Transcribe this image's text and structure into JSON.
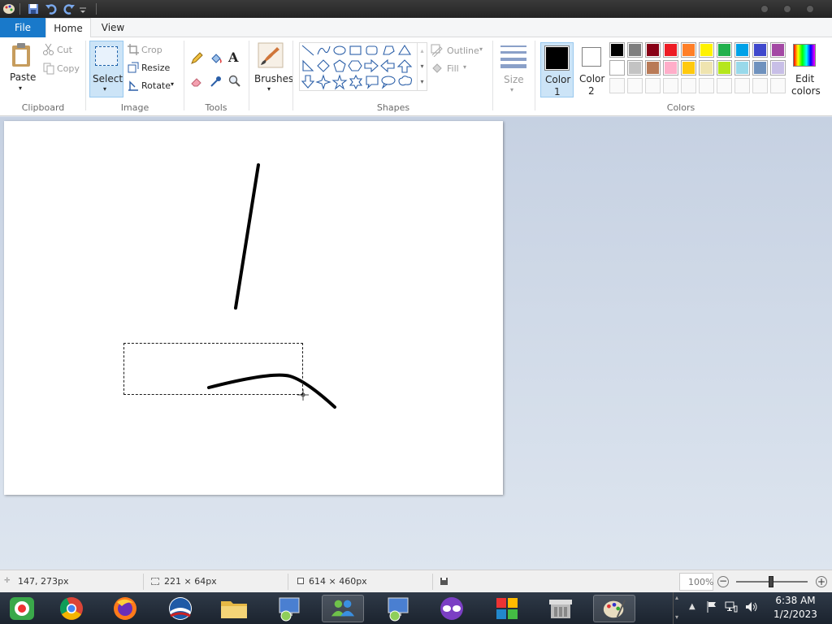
{
  "ribbon_tabs": {
    "file": "File",
    "home": "Home",
    "view": "View"
  },
  "clipboard": {
    "paste": "Paste",
    "cut": "Cut",
    "copy": "Copy",
    "label": "Clipboard"
  },
  "image": {
    "select": "Select",
    "crop": "Crop",
    "resize": "Resize",
    "rotate": "Rotate",
    "label": "Image"
  },
  "tools": {
    "label": "Tools"
  },
  "brushes": {
    "label": "Brushes"
  },
  "shapes": {
    "outline": "Outline",
    "fill": "Fill",
    "label": "Shapes"
  },
  "size": {
    "label": "Size"
  },
  "colors": {
    "color1_label": "Color",
    "color1_index": "1",
    "color2_label": "Color",
    "color2_index": "2",
    "edit_label": "Edit",
    "edit_label2": "colors",
    "label": "Colors",
    "color1_value": "#000000",
    "color2_value": "#ffffff",
    "palette_row1": [
      "#000000",
      "#7f7f7f",
      "#880015",
      "#ed1c24",
      "#ff7f27",
      "#fff200",
      "#22b14c",
      "#00a2e8",
      "#3f48cc",
      "#a349a4"
    ],
    "palette_row2": [
      "#ffffff",
      "#c3c3c3",
      "#b97a57",
      "#ffaec9",
      "#ffc90e",
      "#efe4b0",
      "#b5e61d",
      "#99d9ea",
      "#7092be",
      "#c8bfe7"
    ]
  },
  "status": {
    "cursor_pos": "147, 273px",
    "selection_size": "221 × 64px",
    "image_size": "614 × 460px",
    "zoom": "100%"
  },
  "clock": {
    "time": "6:38 AM",
    "date": "1/2/2023"
  }
}
